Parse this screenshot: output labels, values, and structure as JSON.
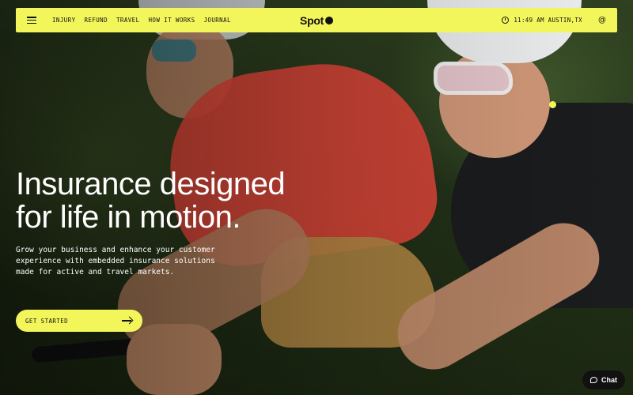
{
  "nav": {
    "links": [
      "INJURY",
      "REFUND",
      "TRAVEL",
      "HOW IT WORKS",
      "JOURNAL"
    ],
    "logo": "Spot",
    "time_location": "11:49 AM AUSTIN,TX"
  },
  "hero": {
    "headline_line1": "Insurance designed",
    "headline_line2": "for life in motion.",
    "subtext_line1": "Grow your business and enhance your customer",
    "subtext_line2": "experience with embedded insurance solutions",
    "subtext_line3": "made for active and travel markets.",
    "cta_label": "GET STARTED"
  },
  "chat": {
    "label": "Chat"
  },
  "colors": {
    "accent": "#f3f65a",
    "text_dark": "#111111",
    "text_light": "#ffffff"
  },
  "icons": [
    "menu-icon",
    "clock-icon",
    "at-icon",
    "arrow-right-icon",
    "chat-bubble-icon"
  ]
}
